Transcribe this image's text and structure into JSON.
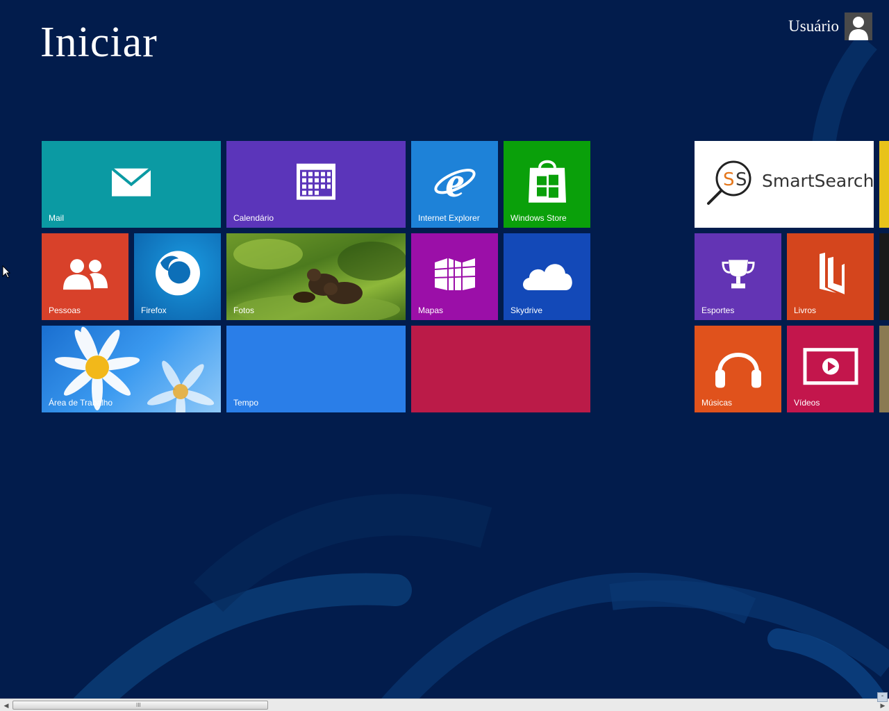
{
  "start": {
    "title": "Iniciar",
    "user_name": "Usuário"
  },
  "tiles": {
    "mail": {
      "label": "Mail",
      "color": "#0b9aa3"
    },
    "calendario": {
      "label": "Calendário",
      "color": "#5b35ba"
    },
    "internet_explorer": {
      "label": "Internet Explorer",
      "color": "#1e82d8"
    },
    "windows_store": {
      "label": "Windows Store",
      "color": "#0aa00a"
    },
    "pessoas": {
      "label": "Pessoas",
      "color": "#d8412a"
    },
    "firefox": {
      "label": "Firefox",
      "color": "#0c7cc2"
    },
    "fotos": {
      "label": "Fotos",
      "color": "#4c7a1e"
    },
    "mapas": {
      "label": "Mapas",
      "color": "#9b0fa8"
    },
    "skydrive": {
      "label": "Skydrive",
      "color": "#1349b8"
    },
    "area_de_trabalho": {
      "label": "Área de Trabalho",
      "color": "#2a8be0"
    },
    "tempo": {
      "label": "Tempo",
      "color": "#2a7ee8"
    },
    "unnamed_red": {
      "label": "",
      "color": "#bb1b48"
    },
    "smartsearch": {
      "label": "SmartSearch",
      "color": "#ffffff"
    },
    "esportes": {
      "label": "Esportes",
      "color": "#6334b4"
    },
    "livros": {
      "label": "Livros",
      "color": "#d4451d"
    },
    "musicas": {
      "label": "Músicas",
      "color": "#e0521c"
    },
    "videos": {
      "label": "Vídeos",
      "color": "#c3164c"
    }
  },
  "scrollbar": {
    "grip": "III",
    "zoom": "-"
  },
  "colors": {
    "background": "#021c4c"
  }
}
